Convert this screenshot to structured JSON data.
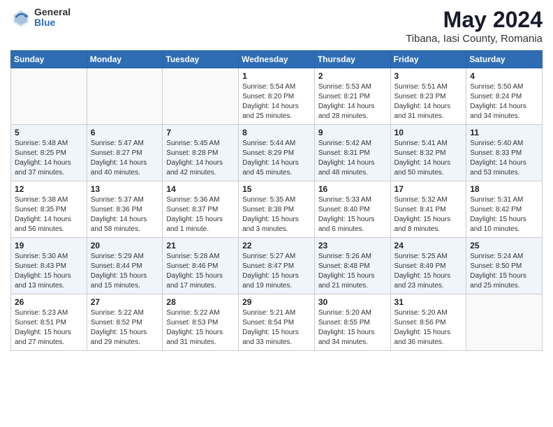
{
  "header": {
    "logo_general": "General",
    "logo_blue": "Blue",
    "main_title": "May 2024",
    "subtitle": "Tibana, Iasi County, Romania"
  },
  "calendar": {
    "days_of_week": [
      "Sunday",
      "Monday",
      "Tuesday",
      "Wednesday",
      "Thursday",
      "Friday",
      "Saturday"
    ],
    "weeks": [
      [
        {
          "day": "",
          "info": ""
        },
        {
          "day": "",
          "info": ""
        },
        {
          "day": "",
          "info": ""
        },
        {
          "day": "1",
          "info": "Sunrise: 5:54 AM\nSunset: 8:20 PM\nDaylight: 14 hours\nand 25 minutes."
        },
        {
          "day": "2",
          "info": "Sunrise: 5:53 AM\nSunset: 8:21 PM\nDaylight: 14 hours\nand 28 minutes."
        },
        {
          "day": "3",
          "info": "Sunrise: 5:51 AM\nSunset: 8:23 PM\nDaylight: 14 hours\nand 31 minutes."
        },
        {
          "day": "4",
          "info": "Sunrise: 5:50 AM\nSunset: 8:24 PM\nDaylight: 14 hours\nand 34 minutes."
        }
      ],
      [
        {
          "day": "5",
          "info": "Sunrise: 5:48 AM\nSunset: 8:25 PM\nDaylight: 14 hours\nand 37 minutes."
        },
        {
          "day": "6",
          "info": "Sunrise: 5:47 AM\nSunset: 8:27 PM\nDaylight: 14 hours\nand 40 minutes."
        },
        {
          "day": "7",
          "info": "Sunrise: 5:45 AM\nSunset: 8:28 PM\nDaylight: 14 hours\nand 42 minutes."
        },
        {
          "day": "8",
          "info": "Sunrise: 5:44 AM\nSunset: 8:29 PM\nDaylight: 14 hours\nand 45 minutes."
        },
        {
          "day": "9",
          "info": "Sunrise: 5:42 AM\nSunset: 8:31 PM\nDaylight: 14 hours\nand 48 minutes."
        },
        {
          "day": "10",
          "info": "Sunrise: 5:41 AM\nSunset: 8:32 PM\nDaylight: 14 hours\nand 50 minutes."
        },
        {
          "day": "11",
          "info": "Sunrise: 5:40 AM\nSunset: 8:33 PM\nDaylight: 14 hours\nand 53 minutes."
        }
      ],
      [
        {
          "day": "12",
          "info": "Sunrise: 5:38 AM\nSunset: 8:35 PM\nDaylight: 14 hours\nand 56 minutes."
        },
        {
          "day": "13",
          "info": "Sunrise: 5:37 AM\nSunset: 8:36 PM\nDaylight: 14 hours\nand 58 minutes."
        },
        {
          "day": "14",
          "info": "Sunrise: 5:36 AM\nSunset: 8:37 PM\nDaylight: 15 hours\nand 1 minute."
        },
        {
          "day": "15",
          "info": "Sunrise: 5:35 AM\nSunset: 8:38 PM\nDaylight: 15 hours\nand 3 minutes."
        },
        {
          "day": "16",
          "info": "Sunrise: 5:33 AM\nSunset: 8:40 PM\nDaylight: 15 hours\nand 6 minutes."
        },
        {
          "day": "17",
          "info": "Sunrise: 5:32 AM\nSunset: 8:41 PM\nDaylight: 15 hours\nand 8 minutes."
        },
        {
          "day": "18",
          "info": "Sunrise: 5:31 AM\nSunset: 8:42 PM\nDaylight: 15 hours\nand 10 minutes."
        }
      ],
      [
        {
          "day": "19",
          "info": "Sunrise: 5:30 AM\nSunset: 8:43 PM\nDaylight: 15 hours\nand 13 minutes."
        },
        {
          "day": "20",
          "info": "Sunrise: 5:29 AM\nSunset: 8:44 PM\nDaylight: 15 hours\nand 15 minutes."
        },
        {
          "day": "21",
          "info": "Sunrise: 5:28 AM\nSunset: 8:46 PM\nDaylight: 15 hours\nand 17 minutes."
        },
        {
          "day": "22",
          "info": "Sunrise: 5:27 AM\nSunset: 8:47 PM\nDaylight: 15 hours\nand 19 minutes."
        },
        {
          "day": "23",
          "info": "Sunrise: 5:26 AM\nSunset: 8:48 PM\nDaylight: 15 hours\nand 21 minutes."
        },
        {
          "day": "24",
          "info": "Sunrise: 5:25 AM\nSunset: 8:49 PM\nDaylight: 15 hours\nand 23 minutes."
        },
        {
          "day": "25",
          "info": "Sunrise: 5:24 AM\nSunset: 8:50 PM\nDaylight: 15 hours\nand 25 minutes."
        }
      ],
      [
        {
          "day": "26",
          "info": "Sunrise: 5:23 AM\nSunset: 8:51 PM\nDaylight: 15 hours\nand 27 minutes."
        },
        {
          "day": "27",
          "info": "Sunrise: 5:22 AM\nSunset: 8:52 PM\nDaylight: 15 hours\nand 29 minutes."
        },
        {
          "day": "28",
          "info": "Sunrise: 5:22 AM\nSunset: 8:53 PM\nDaylight: 15 hours\nand 31 minutes."
        },
        {
          "day": "29",
          "info": "Sunrise: 5:21 AM\nSunset: 8:54 PM\nDaylight: 15 hours\nand 33 minutes."
        },
        {
          "day": "30",
          "info": "Sunrise: 5:20 AM\nSunset: 8:55 PM\nDaylight: 15 hours\nand 34 minutes."
        },
        {
          "day": "31",
          "info": "Sunrise: 5:20 AM\nSunset: 8:56 PM\nDaylight: 15 hours\nand 36 minutes."
        },
        {
          "day": "",
          "info": ""
        }
      ]
    ]
  }
}
